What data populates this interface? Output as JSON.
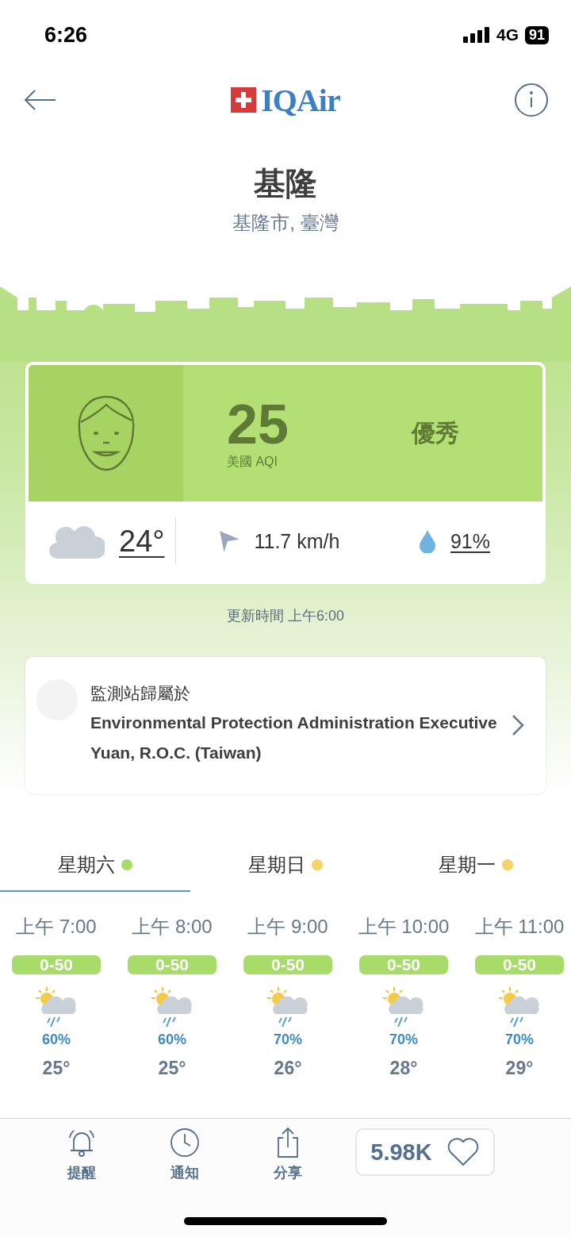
{
  "status_bar": {
    "time": "6:26",
    "network": "4G",
    "battery": "91"
  },
  "header": {
    "logo_text": "IQAir"
  },
  "location": {
    "city": "基隆",
    "region": "基隆市, 臺灣"
  },
  "aqi": {
    "value": "25",
    "unit_label": "美國 AQI",
    "level_label": "優秀"
  },
  "weather": {
    "temperature": "24°",
    "wind": "11.7 km/h",
    "humidity": "91%"
  },
  "updated": "更新時間 上午6:00",
  "station": {
    "label": "監測站歸屬於",
    "name": "Environmental Protection Administration Executive Yuan, R.O.C. (Taiwan)"
  },
  "days": [
    {
      "label": "星期六",
      "selected": true,
      "color": "#a8dc6a"
    },
    {
      "label": "星期日",
      "selected": false,
      "color": "#f5d266"
    },
    {
      "label": "星期一",
      "selected": false,
      "color": "#f5d266"
    }
  ],
  "hours": [
    {
      "time": "上午 7:00",
      "aqi_range": "0-50",
      "rain": "60%",
      "temp": "25°"
    },
    {
      "time": "上午 8:00",
      "aqi_range": "0-50",
      "rain": "60%",
      "temp": "25°"
    },
    {
      "time": "上午 9:00",
      "aqi_range": "0-50",
      "rain": "70%",
      "temp": "26°"
    },
    {
      "time": "上午 10:00",
      "aqi_range": "0-50",
      "rain": "70%",
      "temp": "28°"
    },
    {
      "time": "上午 11:00",
      "aqi_range": "0-50",
      "rain": "70%",
      "temp": "29°"
    }
  ],
  "bottom_bar": {
    "items": [
      {
        "kind": "bell",
        "label": "提醒"
      },
      {
        "kind": "clock",
        "label": "通知"
      },
      {
        "kind": "share",
        "label": "分享"
      }
    ],
    "likes": "5.98K"
  }
}
